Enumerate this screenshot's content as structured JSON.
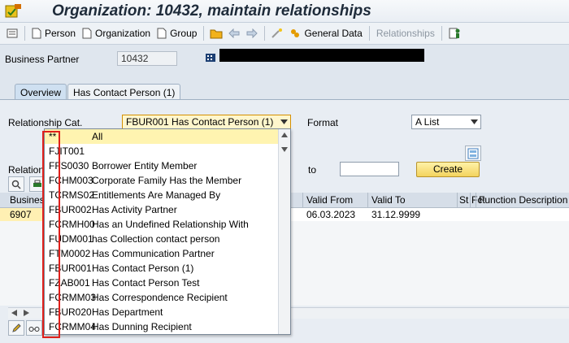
{
  "window": {
    "title": "Organization: 10432, maintain relationships"
  },
  "toolbar": {
    "person": "Person",
    "organization": "Organization",
    "group": "Group",
    "general_data": "General Data",
    "relationships": "Relationships"
  },
  "business_partner": {
    "label": "Business Partner",
    "value": "10432"
  },
  "tabs": [
    {
      "label": "Overview",
      "active": true
    },
    {
      "label": "Has Contact Person (1)",
      "active": false
    }
  ],
  "form": {
    "relationship_cat_label": "Relationship Cat.",
    "relationship_cat_value": "FBUR001 Has Contact Person (1)",
    "format_label": "Format",
    "format_value": "A List",
    "relations_label": "Relations",
    "to_label": "to",
    "to_value": "",
    "create_button": "Create"
  },
  "grid": {
    "columns": [
      "Business",
      "Valid From",
      "Valid To",
      "St",
      "Fct",
      "Function Description"
    ],
    "rows": [
      {
        "partner": "6907",
        "valid_from": "06.03.2023",
        "valid_to": "31.12.9999"
      }
    ]
  },
  "dropdown": {
    "items": [
      {
        "key": "**",
        "text": "All",
        "selected": true
      },
      {
        "key": "FJIT001",
        "text": ""
      },
      {
        "key": "FFS0030",
        "text": "Borrower Entity Member"
      },
      {
        "key": "FCHM003",
        "text": "Corporate Family Has the Member"
      },
      {
        "key": "TCRMS02",
        "text": "Entitlements Are Managed By"
      },
      {
        "key": "FBUR002",
        "text": "Has Activity Partner"
      },
      {
        "key": "FCRMH00",
        "text": "Has an Undefined Relationship With"
      },
      {
        "key": "FUDM001",
        "text": "has Collection contact person"
      },
      {
        "key": "FTM0002",
        "text": "Has Communication Partner"
      },
      {
        "key": "FBUR001",
        "text": "Has Contact Person (1)"
      },
      {
        "key": "FZAB001",
        "text": "Has Contact Person Test"
      },
      {
        "key": "FCRMM03",
        "text": "Has Correspondence Recipient"
      },
      {
        "key": "FBUR020",
        "text": "Has Department"
      },
      {
        "key": "FCRMM04",
        "text": "Has Dunning Recipient"
      }
    ]
  },
  "colors": {
    "accent_yellow": "#fff4b0",
    "highlight_red": "#e0201b",
    "tab_active": "#cfe0f1"
  },
  "icons": [
    "app-icon",
    "display-icon",
    "person-icon",
    "organization-icon",
    "group-icon",
    "open-folder-icon",
    "back-arrow-icon",
    "forward-arrow-icon",
    "magic-wand-icon",
    "general-data-icon",
    "relationships-icon",
    "dropdown-arrow-icon",
    "zoom-icon",
    "print-icon",
    "edit-pencil-icon",
    "glasses-icon",
    "sort-icon"
  ]
}
